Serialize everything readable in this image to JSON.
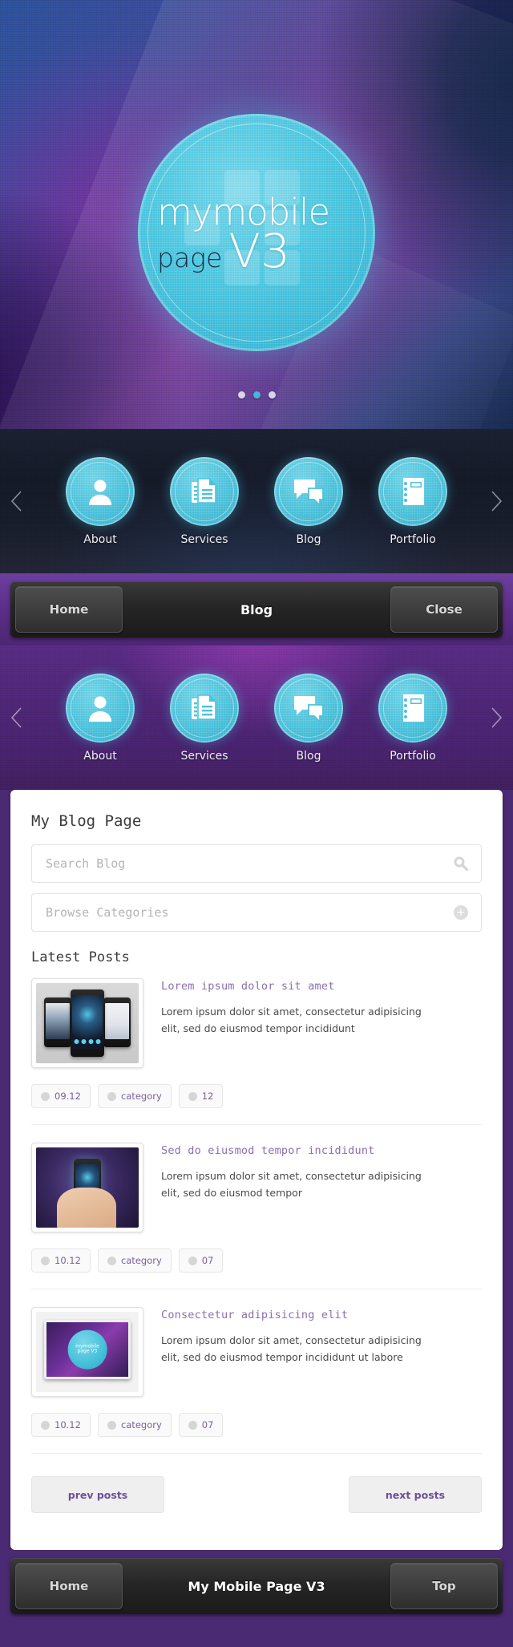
{
  "hero": {
    "logo_line1": "mymobile",
    "logo_line2": "page",
    "logo_line3": "V3",
    "slider_dots": 3,
    "active_dot": 1
  },
  "icon_nav": {
    "prev_label": "prev",
    "next_label": "next",
    "items": [
      {
        "label": "About",
        "icon": "person-icon"
      },
      {
        "label": "Services",
        "icon": "documents-icon"
      },
      {
        "label": "Blog",
        "icon": "chat-bubbles-icon"
      },
      {
        "label": "Portfolio",
        "icon": "notebook-icon"
      }
    ]
  },
  "top_bar": {
    "left_label": "Home",
    "title": "Blog",
    "right_label": "Close"
  },
  "bottom_bar": {
    "left_label": "Home",
    "title": "My Mobile Page V3",
    "right_label": "Top"
  },
  "content": {
    "page_title": "My Blog Page",
    "search": {
      "placeholder": "Search Blog",
      "icon": "search-icon"
    },
    "categories": {
      "label": "Browse Categories",
      "icon": "plus-circle-icon"
    },
    "latest_posts_heading": "Latest Posts",
    "posts": [
      {
        "title": "Lorem ipsum dolor sit amet",
        "excerpt": "Lorem ipsum dolor sit amet, consectetur adipisicing elit, sed do eiusmod tempor incididunt",
        "thumb": "three-phones-image",
        "meta": {
          "date": "09.12",
          "category": "category",
          "comments": "12"
        }
      },
      {
        "title": "Sed do eiusmod tempor incididunt",
        "excerpt": "Lorem ipsum dolor sit amet, consectetur adipisicing elit, sed do eiusmod tempor",
        "thumb": "hand-holding-phone-image",
        "meta": {
          "date": "10.12",
          "category": "category",
          "comments": "07"
        }
      },
      {
        "title": "Consectetur adipisicing elit",
        "excerpt": "Lorem ipsum dolor sit amet, consectetur adipisicing elit, sed do eiusmod tempor incididunt ut labore",
        "thumb": "tablet-logo-image",
        "meta": {
          "date": "10.12",
          "category": "category",
          "comments": "07"
        }
      }
    ],
    "pager": {
      "prev_label": "prev posts",
      "next_label": "next posts"
    }
  },
  "colors": {
    "brand_cyan": "#4cc2db",
    "purple_frame": "#4a2a72",
    "accent_link": "#8a6fb0",
    "pager_text": "#6d4f9b"
  }
}
